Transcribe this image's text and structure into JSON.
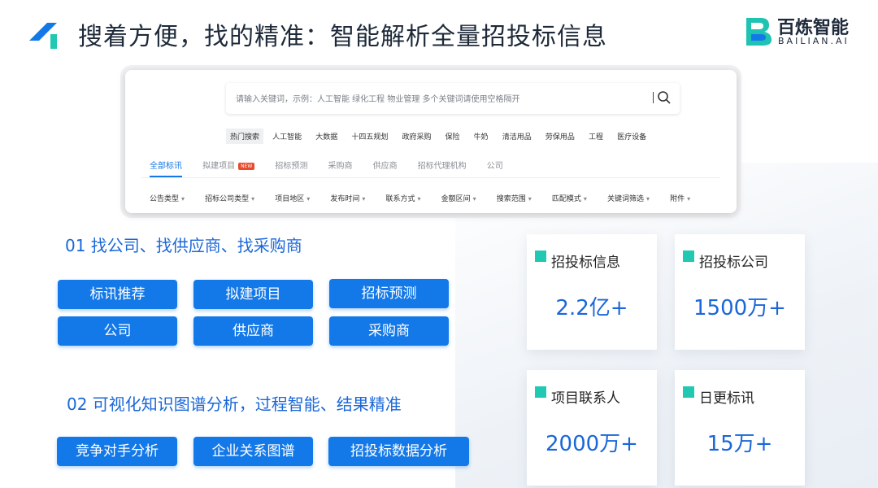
{
  "header": {
    "title": "搜着方便，找的精准：智能解析全量招投标信息",
    "brand_name": "百炼智能",
    "brand_sub": "BAILIAN.AI"
  },
  "search": {
    "placeholder": "请输入关键词，示例：人工智能 绿化工程 物业管理 多个关键词请使用空格隔开",
    "hot_label": "热门搜索",
    "hot_keywords": [
      "人工智能",
      "大数据",
      "十四五规划",
      "政府采购",
      "保险",
      "牛奶",
      "清洁用品",
      "劳保用品",
      "工程",
      "医疗设备"
    ],
    "tabs": [
      {
        "label": "全部标讯",
        "active": true
      },
      {
        "label": "拟建项目",
        "badge": "NEW"
      },
      {
        "label": "招标预测"
      },
      {
        "label": "采购商"
      },
      {
        "label": "供应商"
      },
      {
        "label": "招标代理机构"
      },
      {
        "label": "公司"
      }
    ],
    "filters": [
      "公告类型",
      "招标公司类型",
      "项目地区",
      "发布时间",
      "联系方式",
      "金额区间",
      "搜索范围",
      "匹配模式",
      "关键词筛选",
      "附件"
    ]
  },
  "section1": {
    "title": "01 找公司、找供应商、找采购商",
    "buttons": [
      "标讯推荐",
      "拟建项目",
      "招标预测",
      "公司",
      "供应商",
      "采购商"
    ]
  },
  "section2": {
    "title": "02 可视化知识图谱分析，过程智能、结果精准",
    "buttons": [
      "竞争对手分析",
      "企业关系图谱",
      "招投标数据分析"
    ]
  },
  "stats": [
    {
      "label": "招投标信息",
      "value": "2.2亿+"
    },
    {
      "label": "招投标公司",
      "value": "1500万+"
    },
    {
      "label": "项目联系人",
      "value": "2000万+"
    },
    {
      "label": "日更标讯",
      "value": "15万+"
    }
  ],
  "colors": {
    "accent": "#1479e8",
    "title_blue": "#1a67d8",
    "stat_square": "#22c9b2",
    "new_badge": "#e84a2b"
  }
}
